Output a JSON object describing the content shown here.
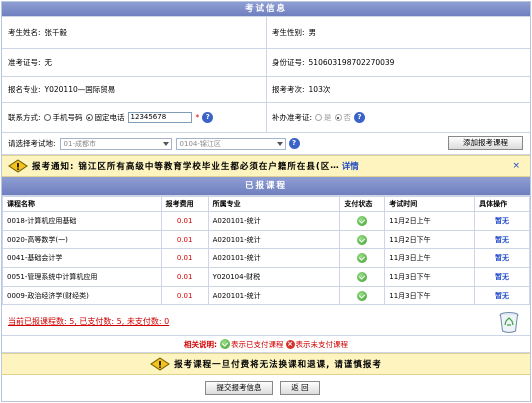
{
  "header": {
    "title": "考试信息"
  },
  "info": {
    "name_label": "考生姓名:",
    "name_value": "张千毅",
    "gender_label": "考生性别:",
    "gender_value": "男",
    "ticket_label": "准考证号:",
    "ticket_value": "无",
    "idcard_label": "身份证号:",
    "idcard_value": "510603198702270039",
    "major_label": "报名专业:",
    "major_value": "Y020110—国际贸易",
    "count_label": "报考考次:",
    "count_value": "103次"
  },
  "contact": {
    "label": "联系方式:",
    "option_mobile": "手机号码",
    "option_phone": "固定电话",
    "phone_value": "12345678",
    "required_mark": "*",
    "reissue_label": "补办准考证:",
    "reissue_yes": "是",
    "reissue_no": "否"
  },
  "location": {
    "label": "请选择考试地:",
    "city_value": "01-成都市",
    "district_value": "0104-锦江区",
    "add_button": "添加报考课程"
  },
  "notice": {
    "text": "报考通知: 锦江区所有高级中等教育学校毕业生都必须在户籍所在县(区",
    "ellipsis": "…",
    "detail_link": "详情",
    "close": "×"
  },
  "registered": {
    "title": "已报课程",
    "columns": [
      "课程名称",
      "报考费用",
      "所属专业",
      "支付状态",
      "考试时间",
      "具体操作"
    ],
    "rows": [
      {
        "course": "0018-计算机应用基础",
        "fee": "0.01",
        "major": "A020101-统计",
        "time": "11月2日上午",
        "action": "暂无"
      },
      {
        "course": "0020-高等数学(一)",
        "fee": "0.01",
        "major": "A020101-统计",
        "time": "11月2日下午",
        "action": "暂无"
      },
      {
        "course": "0041-基础会计学",
        "fee": "0.01",
        "major": "A020101-统计",
        "time": "11月3日上午",
        "action": "暂无"
      },
      {
        "course": "0051-管理系统中计算机应用",
        "fee": "0.01",
        "major": "Y020104-财税",
        "time": "11月3日下午",
        "action": "暂无"
      },
      {
        "course": "0009-政治经济学(财经类)",
        "fee": "0.01",
        "major": "A020101-统计",
        "time": "11月3日下午",
        "action": "暂无"
      }
    ]
  },
  "summary": {
    "text": "当前已报课程数: 5, 已支付数: 5, 未支付数: 0"
  },
  "legend": {
    "label": "相关说明:",
    "paid": "表示已支付课程",
    "unpaid": "表示未支付课程"
  },
  "warning": {
    "text": "报考课程一旦付费将无法换课和退课, 请谨慎报考"
  },
  "actions": {
    "submit": "提交报考信息",
    "back": "返 回"
  }
}
